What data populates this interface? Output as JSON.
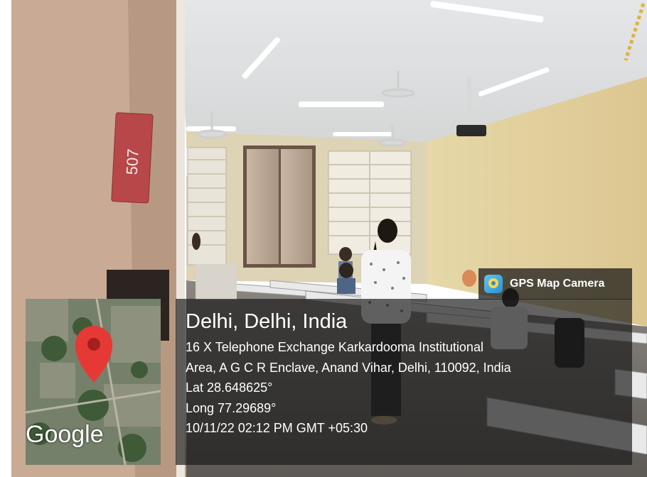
{
  "room_sign": {
    "number": "507"
  },
  "watermark": {
    "app_name": "GPS Map Camera",
    "app_icon": "gps-map-camera-icon",
    "location_title": "Delhi, Delhi, India",
    "address_line1": "16 X Telephone Exchange Karkardooma Institutional",
    "address_line2": "Area, A G C R Enclave, Anand Vihar, Delhi, 110092, India",
    "latitude": "Lat 28.648625°",
    "longitude": "Long 77.29689°",
    "timestamp": "10/11/22 02:12 PM GMT +05:30"
  },
  "map": {
    "logo": "Google",
    "marker_icon": "map-pin-icon",
    "marker_color": "#e53935"
  }
}
